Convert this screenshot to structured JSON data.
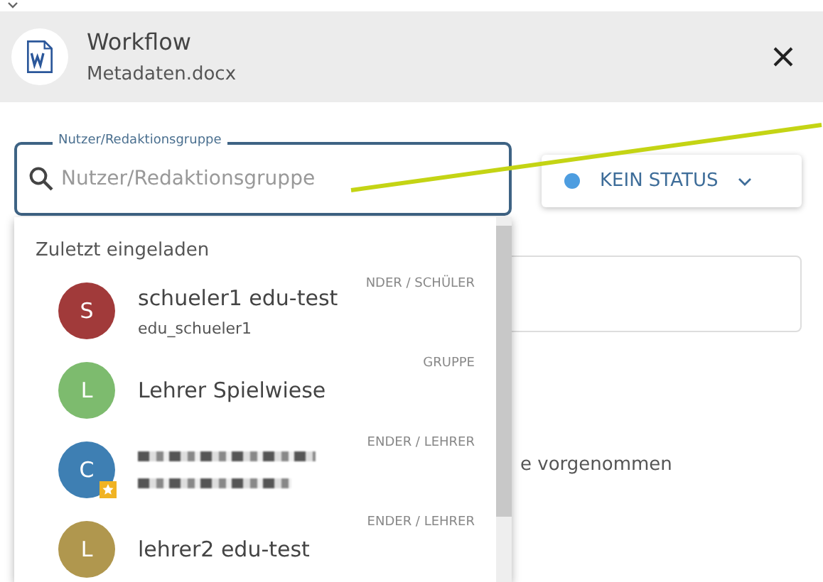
{
  "window": {
    "title": "Workflow",
    "subtitle": "Metadaten.docx"
  },
  "search": {
    "label": "Nutzer/Redaktionsgruppe",
    "placeholder": "Nutzer/Redaktionsgruppe"
  },
  "status": {
    "label": "KEIN STATUS",
    "color": "#4d9de0"
  },
  "background_text": "e vorgenommen",
  "dropdown": {
    "heading": "Zuletzt eingeladen",
    "items": [
      {
        "kind": "person",
        "initial": "S",
        "name": "schueler1 edu-test",
        "username": "edu_schueler1",
        "role": "NDER / SCHÜLER",
        "color": "#a13a3a",
        "starred": false
      },
      {
        "kind": "group",
        "initial": "L",
        "name": "Lehrer Spielwiese",
        "role": "GRUPPE",
        "color": "#7dbb6e",
        "starred": false
      },
      {
        "kind": "redacted",
        "initial": "C",
        "role": "ENDER / LEHRER",
        "color": "#3e7fb3",
        "starred": true
      },
      {
        "kind": "person",
        "initial": "L",
        "name": "lehrer2 edu-test",
        "role": "ENDER / LEHRER",
        "color": "#b0974e",
        "starred": false
      }
    ]
  }
}
